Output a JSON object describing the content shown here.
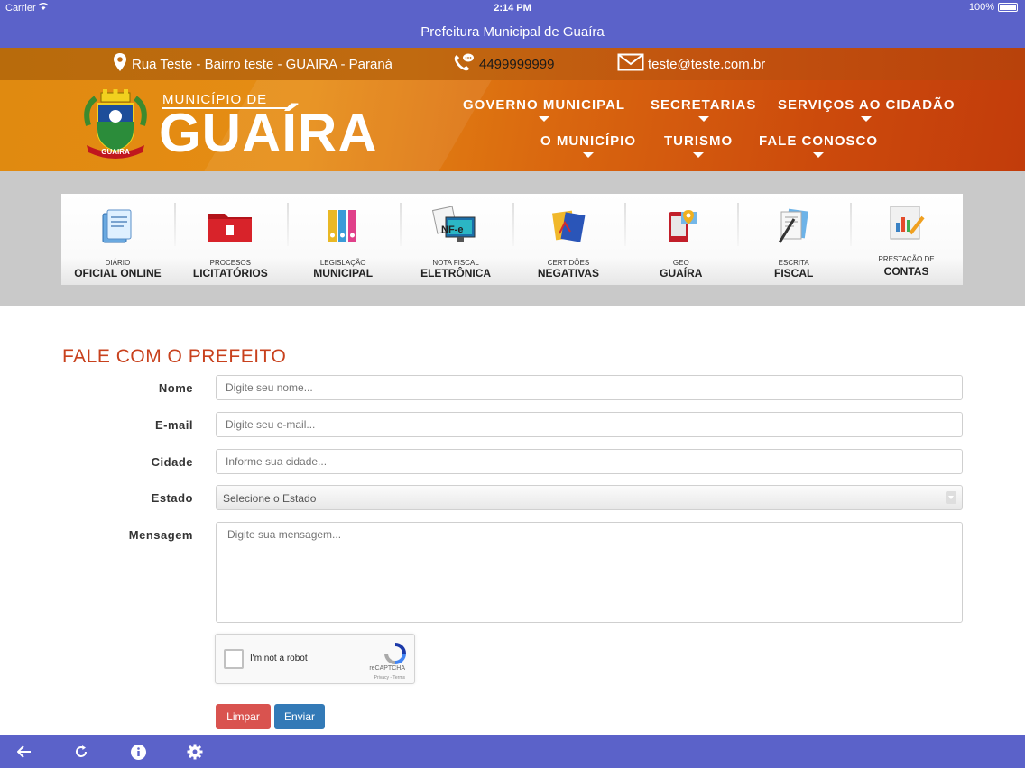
{
  "status_bar": {
    "carrier": "Carrier",
    "time": "2:14 PM",
    "battery": "100%"
  },
  "nav_title": "Prefeitura Municipal de Guaíra",
  "contact": {
    "address": "Rua Teste - Bairro teste - GUAIRA - Paraná",
    "phone": "4499999999",
    "email": "teste@teste.com.br"
  },
  "logo": {
    "small": "MUNICÍPIO DE",
    "big": "GUAÍRA",
    "crest_label": "GUAIRA"
  },
  "menu": {
    "governo": "GOVERNO MUNICIPAL",
    "secretarias": "SECRETARIAS",
    "servicos": "SERVIÇOS AO CIDADÃO",
    "municipio": "O MUNICÍPIO",
    "turismo": "TURISMO",
    "fale": "FALE CONOSCO"
  },
  "tiles": [
    {
      "l1": "DIÁRIO",
      "l2": "OFICIAL ONLINE",
      "icon": "diario-icon"
    },
    {
      "l1": "PROCESOS",
      "l2": "LICITATÓRIOS",
      "icon": "folder-icon"
    },
    {
      "l1": "LEGISLAÇÃO",
      "l2": "MUNICIPAL",
      "icon": "binders-icon"
    },
    {
      "l1": "NOTA FISCAL",
      "l2": "ELETRÔNICA",
      "icon": "nfe-icon"
    },
    {
      "l1": "CERTIDÕES",
      "l2": "NEGATIVAS",
      "icon": "certificates-icon"
    },
    {
      "l1": "GEO",
      "l2": "GUAÍRA",
      "icon": "map-icon"
    },
    {
      "l1": "ESCRITA",
      "l2": "FISCAL",
      "icon": "documents-icon"
    },
    {
      "l1": "PRESTAÇÃO DE",
      "l2": "CONTAS",
      "icon": "report-icon"
    }
  ],
  "form": {
    "title": "FALE COM O PREFEITO",
    "nome_label": "Nome",
    "nome_placeholder": "Digite seu nome...",
    "email_label": "E-mail",
    "email_placeholder": "Digite seu e-mail...",
    "cidade_label": "Cidade",
    "cidade_placeholder": "Informe sua cidade...",
    "estado_label": "Estado",
    "estado_value": "Selecione o Estado",
    "mensagem_label": "Mensagem",
    "mensagem_placeholder": "Digite sua mensagem...",
    "captcha_text": "I'm not a robot",
    "captcha_brand": "reCAPTCHA",
    "captcha_links": "Privacy - Terms",
    "clear_label": "Limpar",
    "send_label": "Enviar"
  },
  "colors": {
    "ios_bar": "#5b62c9",
    "title_red": "#c8411d",
    "clear_btn": "#d9534f",
    "send_btn": "#337ab7"
  },
  "toolbar_icons": [
    "back-arrow-icon",
    "refresh-icon",
    "info-icon",
    "settings-gear-icon"
  ]
}
